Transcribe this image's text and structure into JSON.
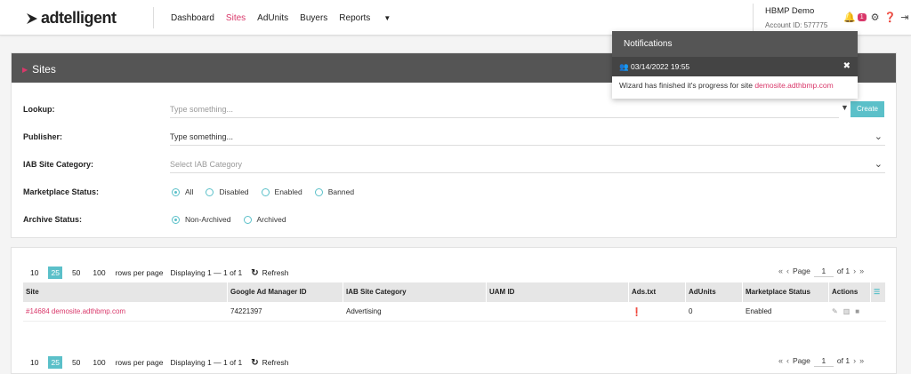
{
  "brand": {
    "name": "adtelligent"
  },
  "nav": {
    "items": [
      "Dashboard",
      "Sites",
      "AdUnits",
      "Buyers",
      "Reports"
    ],
    "active": "Sites"
  },
  "account": {
    "name": "HBMP Demo",
    "id_label": "Account ID: 577775"
  },
  "notifications": {
    "badge_count": "1",
    "title": "Notifications",
    "timestamp": "03/14/2022 19:55",
    "message_prefix": "Wizard has finished it's progress for site ",
    "message_link": "demosite.adthbmp.com"
  },
  "sites_card": {
    "title": "Sites",
    "lookup": {
      "label": "Lookup:",
      "placeholder": "Type something...",
      "create_label": "Create"
    },
    "publisher": {
      "label": "Publisher:",
      "value": "Type something..."
    },
    "iab": {
      "label": "IAB Site Category:",
      "placeholder": "Select IAB Category"
    },
    "marketplace": {
      "label": "Marketplace Status:",
      "options": [
        "All",
        "Disabled",
        "Enabled",
        "Banned"
      ],
      "selected": "All"
    },
    "archive": {
      "label": "Archive Status:",
      "options": [
        "Non-Archived",
        "Archived"
      ],
      "selected": "Non-Archived"
    }
  },
  "table": {
    "rows_per_page_options": [
      "10",
      "25",
      "50",
      "100"
    ],
    "rows_per_page_selected": "25",
    "rows_per_page_label": "rows per page",
    "displaying": "Displaying 1 — 1 of 1",
    "refresh_label": "Refresh",
    "page_label": "Page",
    "page_value": "1",
    "page_of": "of 1",
    "columns": [
      "Site",
      "Google Ad Manager ID",
      "IAB Site Category",
      "UAM ID",
      "Ads.txt",
      "AdUnits",
      "Marketplace Status",
      "Actions"
    ],
    "rows": [
      {
        "site": "#14684 demosite.adthbmp.com",
        "gam_id": "74221397",
        "iab": "Advertising",
        "uam_id": "",
        "adunits": "0",
        "marketplace": "Enabled"
      }
    ]
  },
  "colors": {
    "accent": "#d9386a",
    "teal": "#5bc0c9",
    "header": "#555555"
  }
}
